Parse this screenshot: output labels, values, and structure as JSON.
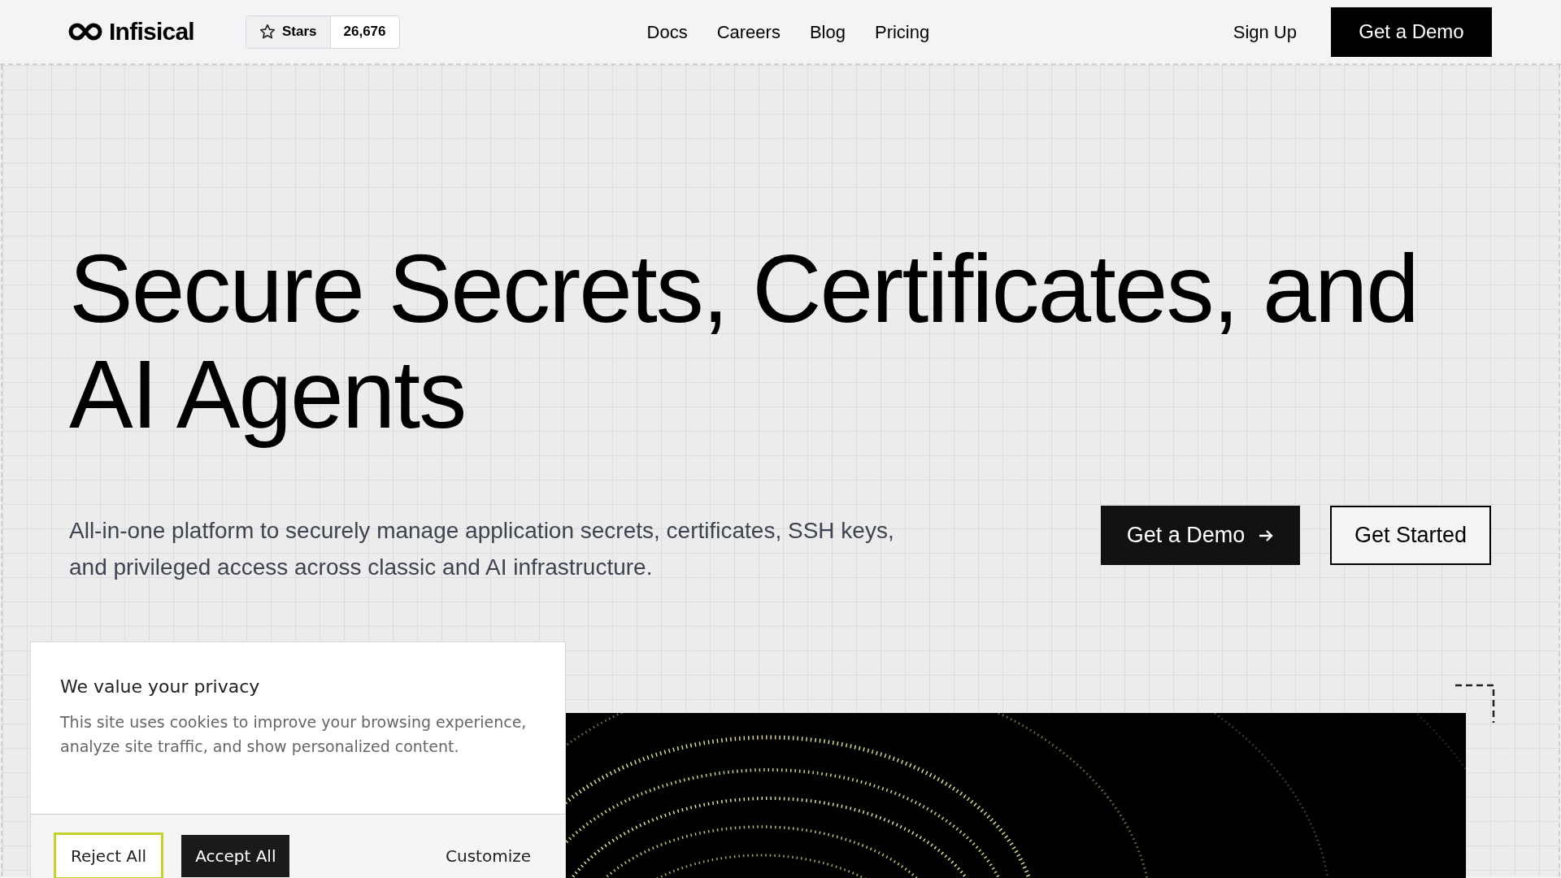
{
  "header": {
    "logo": "Infisical",
    "github": {
      "label": "Stars",
      "count": "26,676"
    },
    "nav": [
      "Docs",
      "Careers",
      "Blog",
      "Pricing"
    ],
    "sign_up": "Sign Up",
    "cta": "Get a Demo"
  },
  "hero": {
    "title_lines": [
      "Secure Secrets, Certificates, and",
      "AI Agents"
    ],
    "subtitle": "All-in-one platform to securely manage application secrets, certificates, SSH keys, and privileged access across classic and AI infrastructure.",
    "primary_button": "Get a Demo",
    "secondary_button": "Get Started",
    "media": {
      "kind": "picture"
    }
  },
  "cookie_banner": {
    "title": "We value your privacy",
    "body": "This site uses cookies to improve your browsing experience, analyze site traffic, and show personalized content.",
    "buttons": [
      {
        "label": "Reject All",
        "kind": "outline"
      },
      {
        "label": "Accept All",
        "kind": "solid"
      },
      {
        "label": "Customize",
        "kind": "text"
      }
    ]
  }
}
